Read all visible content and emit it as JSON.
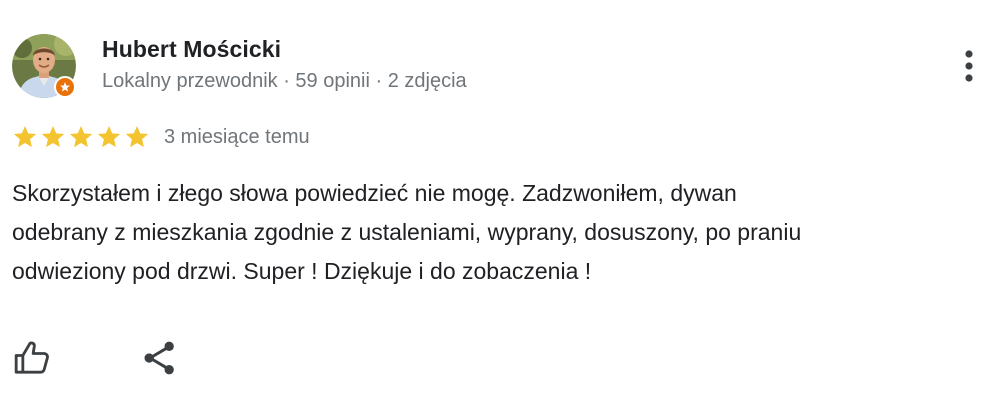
{
  "reviewer": {
    "name": "Hubert Mościcki",
    "meta": "Lokalny przewodnik · 59 opinii · 2 zdjęcia",
    "avatar_icon": "person-photo",
    "badge_icon": "local-guide-star-icon",
    "badge_color": "#e8710a"
  },
  "review": {
    "rating": 5,
    "rating_max": 5,
    "star_color": "#f4c430",
    "date": "3 miesiące temu",
    "text_lines": [
      "Skorzystałem i złego słowa powiedzieć nie mogę. Zadzwoniłem, dywan",
      "odebrany z mieszkania zgodnie z ustaleniami, wyprany, dosuszony, po praniu",
      "odwieziony pod drzwi. Super ! Dziękuje i do zobaczenia !"
    ]
  },
  "actions": {
    "like_icon": "thumbs-up-icon",
    "share_icon": "share-icon",
    "more_icon": "more-vertical-icon"
  }
}
